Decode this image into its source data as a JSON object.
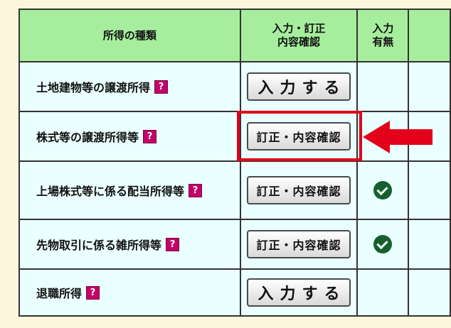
{
  "header": {
    "col_name": "所得の種類",
    "col_action_line1": "入力・訂正",
    "col_action_line2": "内容確認",
    "col_has_line1": "入力",
    "col_has_line2": "有無"
  },
  "rows": [
    {
      "label": "土地建物等の譲渡所得",
      "button": "入力する",
      "has_input": false
    },
    {
      "label": "株式等の譲渡所得等",
      "button": "訂正・内容確認",
      "has_input": false
    },
    {
      "label": "上場株式等に係る配当所得等",
      "button": "訂正・内容確認",
      "has_input": true
    },
    {
      "label": "先物取引に係る雑所得等",
      "button": "訂正・内容確認",
      "has_input": true
    },
    {
      "label": "退職所得",
      "button": "入力する",
      "has_input": false
    }
  ],
  "help_icon_glyph": "?",
  "colors": {
    "header_bg": "#a6ee9e",
    "row_bg": "#eaffff",
    "page_bg": "#fdf6dc",
    "help_icon": "#c4006a",
    "check": "#155f2e",
    "highlight": "#e2001a"
  },
  "icons": [
    "help-icon",
    "checkmark-icon",
    "red-arrow-left-icon"
  ]
}
